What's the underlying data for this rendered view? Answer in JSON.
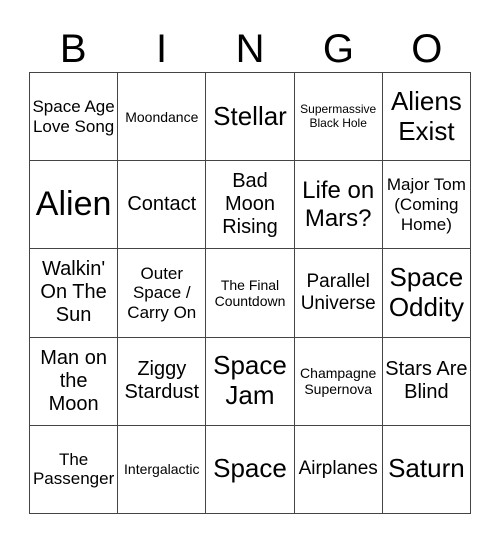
{
  "header": [
    "B",
    "I",
    "N",
    "G",
    "O"
  ],
  "cells": [
    "Space Age Love Song",
    "Moondance",
    "Stellar",
    "Supermassive Black Hole",
    "Aliens Exist",
    "Alien",
    "Contact",
    "Bad Moon Rising",
    "Life on Mars?",
    "Major Tom (Coming Home)",
    "Walkin' On The Sun",
    "Outer Space / Carry On",
    "The Final Countdown",
    "Parallel Universe",
    "Space Oddity",
    "Man on the Moon",
    "Ziggy Stardust",
    "Space Jam",
    "Champagne Supernova",
    "Stars Are Blind",
    "The Passenger",
    "Intergalactic",
    "Space",
    "Airplanes",
    "Saturn"
  ]
}
